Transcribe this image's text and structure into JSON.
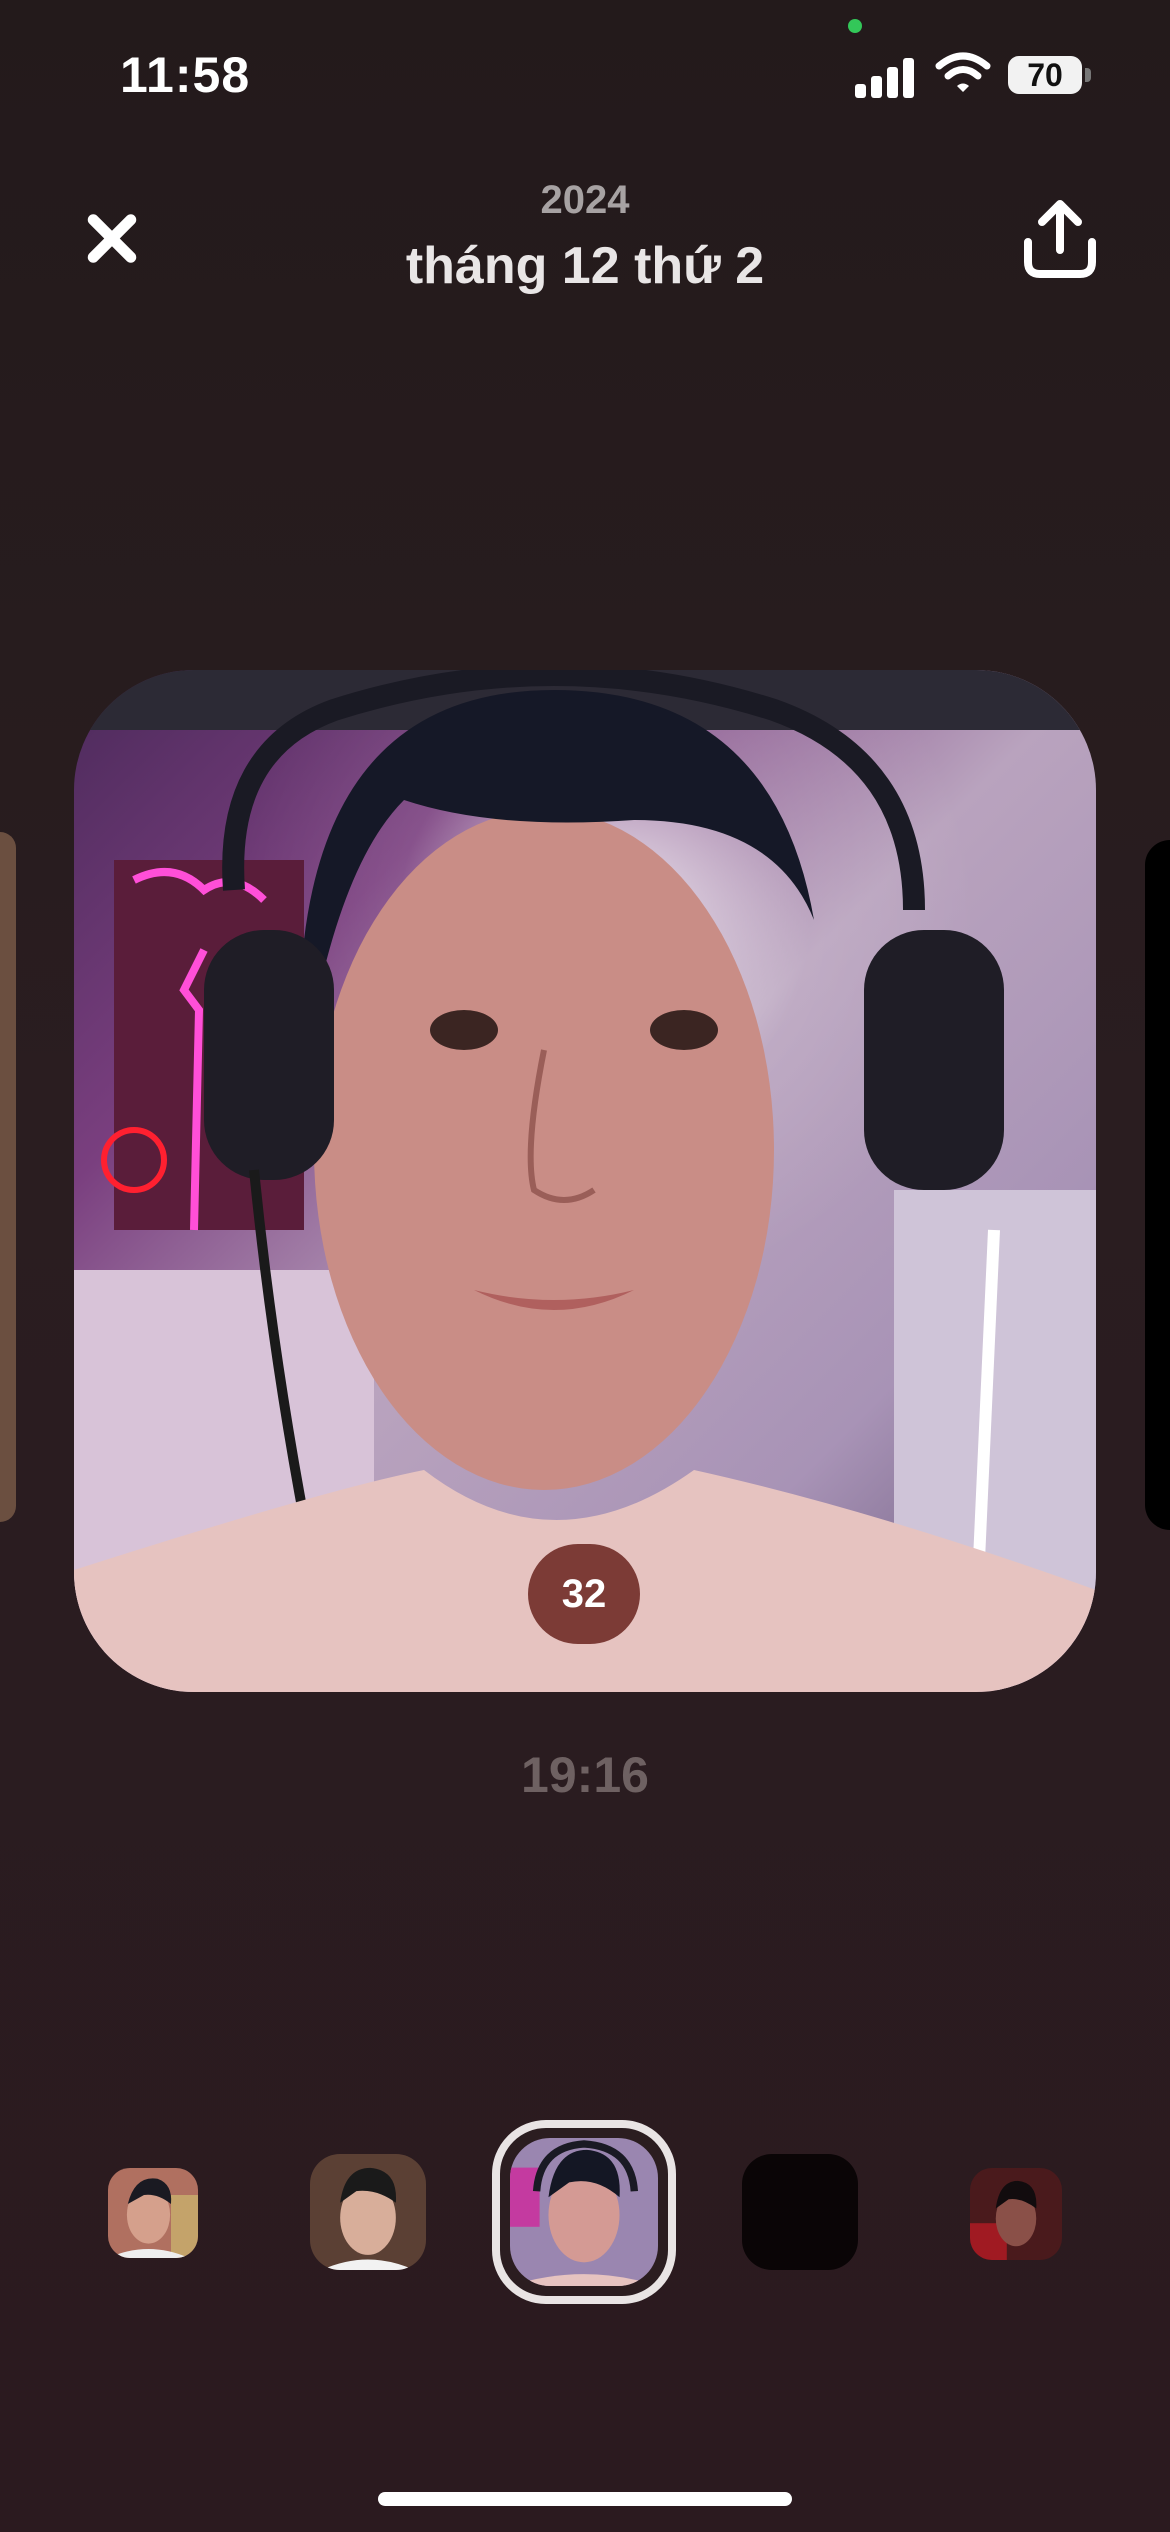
{
  "status_bar": {
    "time": "11:58",
    "battery": "70"
  },
  "header": {
    "year": "2024",
    "date": "tháng 12 thứ 2"
  },
  "photo": {
    "likes": "32",
    "time": "19:16"
  },
  "filmstrip": {
    "selected_index": 2
  }
}
